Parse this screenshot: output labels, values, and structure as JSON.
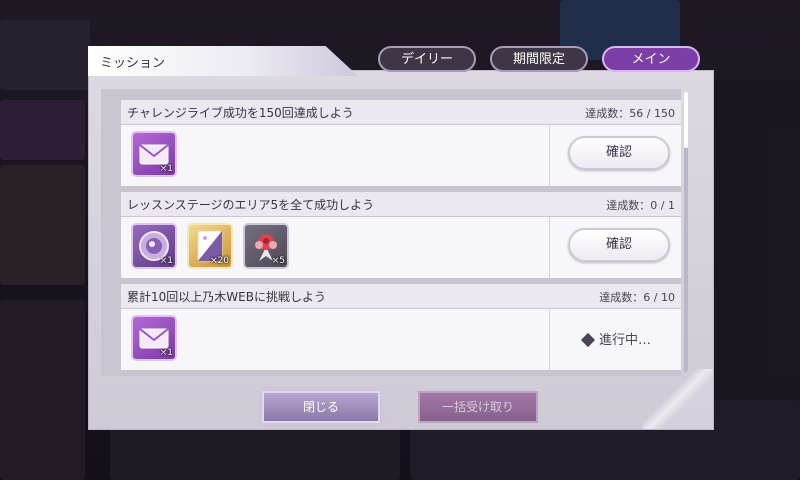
{
  "dialog": {
    "title": "ミッション",
    "tabs": [
      {
        "label": "デイリー",
        "active": false
      },
      {
        "label": "期間限定",
        "active": false
      },
      {
        "label": "メイン",
        "active": true
      }
    ]
  },
  "missions": [
    {
      "title": "チャレンジライブ成功を150回達成しよう",
      "progress": "達成数：56 / 150",
      "rewards": [
        {
          "icon": "mail-ticket-icon",
          "count": "×1"
        }
      ],
      "action": "確認"
    },
    {
      "title": "レッスンステージのエリア5を全て成功しよう",
      "progress": "達成数：0 / 1",
      "rewards": [
        {
          "icon": "medal-icon",
          "count": "×1"
        },
        {
          "icon": "card-icon",
          "count": "×20"
        },
        {
          "icon": "rose-icon",
          "count": "×5"
        }
      ],
      "action": "確認"
    },
    {
      "title": "累計10回以上乃木WEBに挑戦しよう",
      "progress": "達成数：6 / 10",
      "rewards": [
        {
          "icon": "mail-ticket-icon",
          "count": "×1"
        }
      ],
      "status": "進行中…"
    }
  ],
  "footer": {
    "close_label": "閉じる",
    "claim_all_label": "一括受け取り"
  },
  "colors": {
    "active_tab": "#7c3fa8",
    "inactive_tab": "#3e3646",
    "close_button": "#8a79a9",
    "claim_button": "#7a4f80"
  }
}
